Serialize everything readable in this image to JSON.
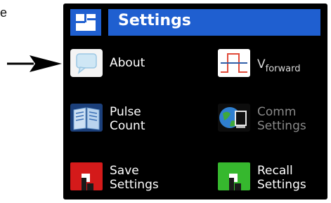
{
  "caption": "e",
  "header": {
    "title": "Settings"
  },
  "menu": {
    "about": {
      "label": "About"
    },
    "vforward": {
      "label_main": "V",
      "label_sub": "forward"
    },
    "pulse_count": {
      "line1": "Pulse",
      "line2": "Count"
    },
    "comm_settings": {
      "line1": "Comm",
      "line2": "Settings"
    },
    "save_settings": {
      "line1": "Save",
      "line2": "Settings"
    },
    "recall_settings": {
      "line1": "Recall",
      "line2": "Settings"
    }
  },
  "colors": {
    "title_bar": "#1f5fd0",
    "screen_bg": "#000000",
    "save_tile": "#d41a1a",
    "recall_tile": "#36b82e",
    "disabled_text": "#8a8a8a"
  },
  "icons": {
    "about": "speech-bubble-icon",
    "vforward": "pulse-waveform-icon",
    "pulse_count": "book-icon",
    "comm_settings": "globe-computer-icon",
    "save_settings": "floppy-disk-icon",
    "recall_settings": "floppy-disk-icon"
  }
}
